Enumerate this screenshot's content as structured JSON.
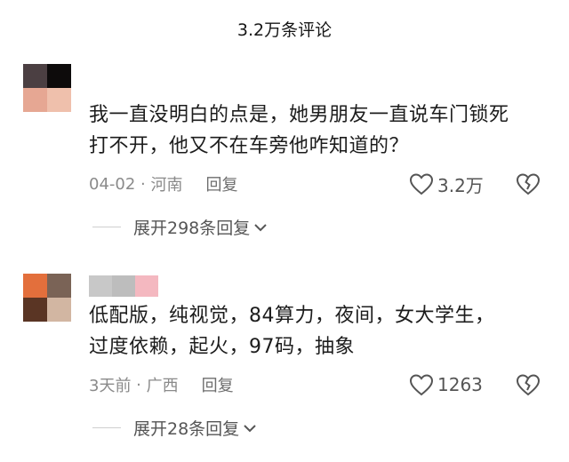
{
  "header": {
    "title": "3.2万条评论"
  },
  "comments": [
    {
      "text_line1": "我一直没明白的点是，她男朋友一直说车门锁死",
      "text_line2": "打不开，他又不在车旁他咋知道的？",
      "date": "04-02",
      "location": "河南",
      "reply_label": "回复",
      "likes": "3.2万",
      "expand_label": "展开298条回复",
      "avatar_colors": [
        "#4b3f42",
        "#0d0b0b",
        "#e6a793",
        "#efc0ac"
      ]
    },
    {
      "text_line1": "低配版，纯视觉，84算力，夜间，女大学生，",
      "text_line2": "过度依赖，起火，97码，抽象",
      "date": "3天前",
      "location": "广西",
      "reply_label": "回复",
      "likes": "1263",
      "expand_label": "展开28条回复",
      "avatar_colors": [
        "#e36f3c",
        "#7a6356",
        "#5a3524",
        "#d2b6a2"
      ],
      "name_colors": [
        "#c8c8c8",
        "#bdbdbd",
        "#f4b8c0"
      ]
    }
  ],
  "colors": {
    "text": "#1c1c1c",
    "meta": "#8a8a8a",
    "icon": "#555555"
  },
  "icons": {
    "like": "heart-outline-icon",
    "dislike": "broken-heart-icon",
    "expand": "chevron-down-icon"
  }
}
